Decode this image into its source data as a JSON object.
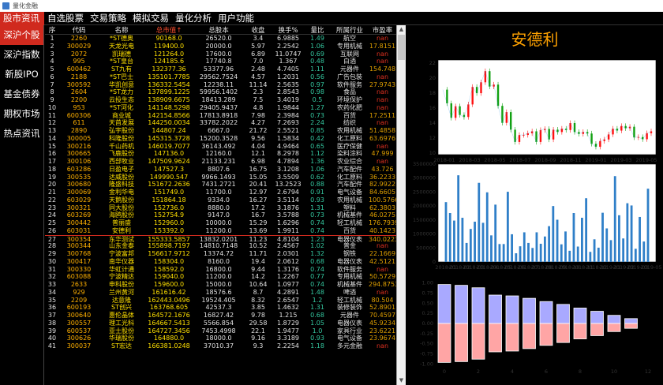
{
  "window": {
    "title": "量化金融"
  },
  "menu": [
    "股市资讯",
    "自选股票",
    "交易策略",
    "模拟交易",
    "量化分析",
    "用户功能"
  ],
  "sidebar": [
    "深沪个股",
    "深沪指数",
    "新股IPO",
    "基金债券",
    "期权市场",
    "热点资讯"
  ],
  "table": {
    "headers": [
      "序",
      "代码",
      "名称",
      "总市值↑",
      "总股本",
      "收盘",
      "换手%",
      "量比",
      "所属行业",
      "市盈率"
    ],
    "rows": [
      [
        "1",
        "2260",
        "*ST德奥",
        "90168.0",
        "26520.0",
        "3.4",
        "6.9885",
        "1.49",
        "航空",
        "nan"
      ],
      [
        "2",
        "300029",
        "天龙光电",
        "119400.0",
        "20000.0",
        "5.97",
        "2.2542",
        "1.06",
        "专用机械",
        "17.8151"
      ],
      [
        "3",
        "2072",
        "凯瑞德",
        "121264.0",
        "17600.0",
        "6.89",
        "11.0747",
        "0.69",
        "互联网",
        "nan"
      ],
      [
        "4",
        "995",
        "*ST皇台",
        "124185.6",
        "17740.8",
        "7.0",
        "1.367",
        "0.48",
        "白酒",
        "nan"
      ],
      [
        "5",
        "600462",
        "ST九有",
        "132377.36",
        "53377.96",
        "2.48",
        "4.7405",
        "1.11",
        "元器件",
        "154.748"
      ],
      [
        "6",
        "2188",
        "*ST巴士",
        "135101.7785",
        "29562.7524",
        "4.57",
        "1.2031",
        "0.56",
        "广告包装",
        "nan"
      ],
      [
        "7",
        "300592",
        "华凯创意",
        "136332.5454",
        "12238.11",
        "11.14",
        "2.5635",
        "0.97",
        "软件服务",
        "27.9743"
      ],
      [
        "8",
        "2604",
        "*ST龙力",
        "137899.1225",
        "59956.1402",
        "2.3",
        "2.8543",
        "0.98",
        "食品",
        "nan"
      ],
      [
        "9",
        "2200",
        "云投生态",
        "138909.6675",
        "18413.289",
        "7.5",
        "3.4019",
        "0.5",
        "环境保护",
        "nan"
      ],
      [
        "10",
        "953",
        "*ST河化",
        "141148.5298",
        "29405.9437",
        "4.8",
        "1.9844",
        "1.27",
        "农药化肥",
        "nan"
      ],
      [
        "11",
        "600306",
        "商业城",
        "142154.8566",
        "17813.8918",
        "7.98",
        "2.3984",
        "0.73",
        "百货",
        "17.2511"
      ],
      [
        "12",
        "611",
        "天首发展",
        "144250.0034",
        "33782.2022",
        "4.27",
        "7.2693",
        "2.24",
        "纺织",
        "nan"
      ],
      [
        "13",
        "2890",
        "弘宇股份",
        "144807.24",
        "6667.0",
        "21.72",
        "2.5521",
        "0.85",
        "农用机械",
        "51.4858"
      ],
      [
        "14",
        "300005",
        "科隆股份",
        "145315.3728",
        "15200.3528",
        "9.56",
        "1.5834",
        "0.42",
        "化工原料",
        "63.6976"
      ],
      [
        "15",
        "300216",
        "千山药机",
        "146019.7077",
        "36143.492",
        "4.04",
        "4.9464",
        "0.65",
        "医疗保健",
        "nan"
      ],
      [
        "16",
        "300665",
        "飞鹿股份",
        "147136.0",
        "12160.0",
        "12.1",
        "8.2978",
        "1.12",
        "染料涂料",
        "47.999"
      ],
      [
        "17",
        "300106",
        "西部牧业",
        "147509.9624",
        "21133.231",
        "6.98",
        "4.7894",
        "1.36",
        "农业综合",
        "nan"
      ],
      [
        "18",
        "603286",
        "日盈电子",
        "147527.3",
        "8807.6",
        "16.75",
        "3.1208",
        "1.06",
        "汽车配件",
        "43.726"
      ],
      [
        "19",
        "300535",
        "达威股份",
        "149990.547",
        "9966.1493",
        "15.05",
        "3.5509",
        "0.62",
        "化工原料",
        "36.2233"
      ],
      [
        "20",
        "300680",
        "隆盛科技",
        "151672.2636",
        "7431.2721",
        "20.41",
        "13.2523",
        "0.88",
        "汽车配件",
        "82.9922"
      ],
      [
        "21",
        "300069",
        "金利华电",
        "151749.0",
        "11700.0",
        "12.97",
        "2.6794",
        "0.91",
        "电气设备",
        "84.6605"
      ],
      [
        "22",
        "603029",
        "天鹅股份",
        "151864.18",
        "9334.0",
        "16.27",
        "3.5114",
        "0.93",
        "农用机械",
        "100.5766"
      ],
      [
        "23",
        "300321",
        "同大股份",
        "152736.0",
        "8880.0",
        "17.2",
        "3.1876",
        "1.31",
        "塑料",
        "62.3803"
      ],
      [
        "24",
        "603269",
        "海鸥股份",
        "152754.9",
        "9147.0",
        "16.7",
        "3.5788",
        "0.73",
        "机械基件",
        "46.0275"
      ],
      [
        "25",
        "300442",
        "普丽盛",
        "152960.0",
        "10000.0",
        "15.29",
        "1.6296",
        "0.74",
        "轻工机械",
        "176.7939"
      ],
      [
        "26",
        "603031",
        "安德利",
        "153392.0",
        "11200.0",
        "13.69",
        "1.9911",
        "0.74",
        "百货",
        "40.1423"
      ],
      [
        "27",
        "300354",
        "东华测试",
        "155333.5857",
        "13832.0201",
        "11.23",
        "4.8104",
        "1.23",
        "电器仪表",
        "340.0223"
      ],
      [
        "28",
        "300344",
        "山东金泰",
        "155898.7197",
        "14810.7148",
        "10.52",
        "2.4567",
        "1.02",
        "普金",
        "nan"
      ],
      [
        "29",
        "300768",
        "宁波富邦",
        "156617.9712",
        "13374.72",
        "11.71",
        "2.0301",
        "1.32",
        "钢铁",
        "22.1669"
      ],
      [
        "30",
        "300417",
        "南华仪器",
        "158304.0",
        "8160.0",
        "19.4",
        "2.0612",
        "0.68",
        "电器仪表",
        "42.5121"
      ],
      [
        "31",
        "300330",
        "华虹计通",
        "158592.0",
        "16800.0",
        "9.44",
        "1.3176",
        "0.74",
        "软件服务",
        "nan"
      ],
      [
        "32",
        "603088",
        "宁波精达",
        "159040.0",
        "11200.0",
        "14.2",
        "1.2267",
        "0.77",
        "专用机械",
        "50.5729"
      ],
      [
        "33",
        "2633",
        "申科股份",
        "159600.0",
        "15000.0",
        "10.64",
        "1.0977",
        "0.74",
        "机械基件",
        "294.8753"
      ],
      [
        "34",
        "929",
        "兰州黄河",
        "161616.42",
        "18576.6",
        "8.7",
        "4.2891",
        "1.48",
        "啤酒",
        "nan"
      ],
      [
        "35",
        "2209",
        "达意隆",
        "162443.0496",
        "19524.405",
        "8.32",
        "2.6547",
        "1.2",
        "轻工机械",
        "80.504"
      ],
      [
        "36",
        "600193",
        "ST创兴",
        "163768.605",
        "42537.3",
        "3.85",
        "1.4632",
        "1.31",
        "装修装饰",
        "52.8901"
      ],
      [
        "37",
        "300640",
        "惠伦晶体",
        "164572.1676",
        "16827.42",
        "9.78",
        "1.215",
        "0.68",
        "元器件",
        "70.4597"
      ],
      [
        "38",
        "300557",
        "理工光科",
        "164667.5413",
        "5566.854",
        "29.58",
        "1.8729",
        "1.05",
        "电器仪表",
        "45.9234"
      ],
      [
        "39",
        "600537",
        "亚士股份",
        "164727.3456",
        "7453.4998",
        "22.1",
        "1.9477",
        "1.0",
        "家具行业",
        "23.6221"
      ],
      [
        "40",
        "300626",
        "华瑞股份",
        "164880.0",
        "18000.0",
        "9.16",
        "3.3189",
        "0.93",
        "电气设备",
        "23.9674"
      ],
      [
        "41",
        "300037",
        "ST宏达",
        "166381.0248",
        "37010.37",
        "9.3",
        "2.2254",
        "1.18",
        "多元金融",
        "nan"
      ]
    ]
  },
  "detail": {
    "stock_name": "安德利"
  },
  "chart_data": [
    {
      "type": "line",
      "series": [
        {
          "name": "",
          "values": [
            18.45,
            16.63,
            14.7,
            16.24,
            15.08,
            14.81,
            16.48,
            18.81,
            17.98,
            19.43,
            20.91,
            18.86,
            19.12,
            16.29,
            14.03,
            15.46,
            13.12,
            11.49,
            12.41,
            12.42,
            12.64,
            12.9,
            11.49,
            13.07,
            13.22,
            11.82,
            13.12,
            12.81,
            13.25,
            13.08,
            14.0,
            12.81,
            12.56,
            12.81,
            12.61,
            11.24,
            10.84,
            11.61,
            11.82,
            12.49,
            13.25,
            13.0,
            13.61,
            13.31,
            13.51,
            12.09,
            12.14,
            11.85,
            12.65,
            12.9
          ]
        }
      ],
      "x": [
        "2018-01",
        "2018-03",
        "2018-05",
        "2018-07",
        "2018-09",
        "2018-11",
        "2019-01",
        "2019-03",
        "2019-05"
      ],
      "yticks": [
        10,
        12,
        14,
        16,
        18,
        20,
        22
      ],
      "ylim": [
        9.8,
        22.4
      ]
    },
    {
      "type": "bar",
      "series": [
        {
          "name": "",
          "values": [
            2140000,
            1750000,
            1480000,
            3100000,
            1580000,
            680000,
            1180000,
            1440000,
            2830000,
            1400000,
            2490000,
            950000,
            2050000,
            640000,
            640000,
            2510000,
            990000,
            310000,
            560000,
            1060000,
            680000,
            500000,
            1060000,
            650000,
            910000,
            1280000,
            2000000,
            1510000,
            630000,
            1090000,
            400000,
            1750000,
            550000,
            1580000,
            2280000,
            360000,
            810000,
            510000,
            1760000,
            1200000,
            780000,
            3070000,
            1670000,
            840000,
            2100000,
            2020000,
            470000,
            1610000,
            730000,
            2620000
          ]
        }
      ],
      "x": [
        "2018-01",
        "2018-02",
        "2018-03",
        "2018-04",
        "2018-05",
        "2018-06",
        "2018-07",
        "2018-08",
        "2018-09",
        "2018-10",
        "2018-11",
        "2018-12",
        "2019-01",
        "2019-02",
        "2019-03",
        "2019-05"
      ],
      "yticks": [
        0,
        500000,
        1000000,
        1500000,
        2000000,
        2500000,
        3000000,
        3500000
      ],
      "ylim": [
        0,
        3500000
      ]
    },
    {
      "type": "bar",
      "series": [
        {
          "name": "pos",
          "values": [
            0.96,
            0.94,
            0.88,
            0.7,
            0.68,
            0.62,
            0.54,
            0.47,
            0.38,
            0.3,
            0.2,
            0.12
          ],
          "color": "#a9a9ff"
        },
        {
          "name": "neg",
          "values": [
            -0.96,
            -0.94,
            -0.88,
            -0.7,
            -0.68,
            -0.62,
            -0.54,
            -0.47,
            -0.38,
            -0.3,
            -0.2,
            -0.12
          ],
          "color": "#ffa5a5"
        }
      ],
      "x": [
        0,
        2,
        4,
        6,
        8,
        10,
        12
      ],
      "yticks": [
        -1.0,
        -0.75,
        -0.5,
        -0.25,
        0.0,
        0.25,
        0.5,
        0.75,
        1.0
      ],
      "ylim": [
        -1.05,
        1.05
      ]
    }
  ]
}
